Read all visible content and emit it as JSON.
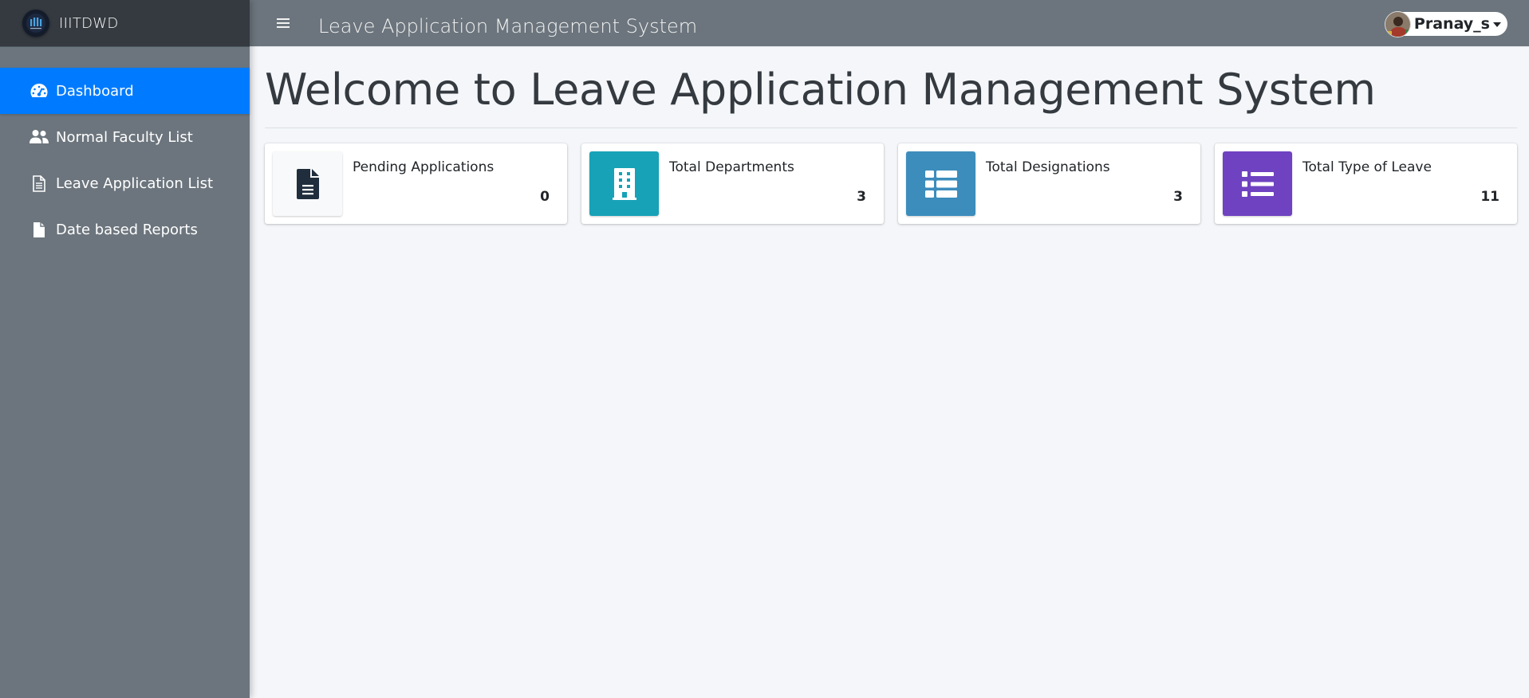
{
  "brand": {
    "name": "IIITDWD"
  },
  "sidebar": {
    "items": [
      {
        "label": "Dashboard",
        "icon": "tachometer-icon",
        "active": true
      },
      {
        "label": "Normal Faculty List",
        "icon": "users-icon",
        "active": false
      },
      {
        "label": "Leave Application List",
        "icon": "file-text-icon",
        "active": false
      },
      {
        "label": "Date based Reports",
        "icon": "file-icon",
        "active": false
      }
    ]
  },
  "topbar": {
    "title": "Leave Application Management System",
    "user": "Pranay_s"
  },
  "main": {
    "title": "Welcome to Leave Application Management System",
    "cards": [
      {
        "label": "Pending Applications",
        "value": "0",
        "icon": "file-alt-icon",
        "color": "#f8f9fa"
      },
      {
        "label": "Total Departments",
        "value": "3",
        "icon": "building-icon",
        "color": "#17a2b8"
      },
      {
        "label": "Total Designations",
        "value": "3",
        "icon": "table-icon",
        "color": "#3c8dbc"
      },
      {
        "label": "Total Type of Leave",
        "value": "11",
        "icon": "list-icon",
        "color": "#6f42c1"
      }
    ]
  },
  "colors": {
    "sidebar_bg": "#6c757d",
    "brand_bg": "#343a40",
    "active_item": "#007bff",
    "content_bg": "#f4f6f9"
  }
}
